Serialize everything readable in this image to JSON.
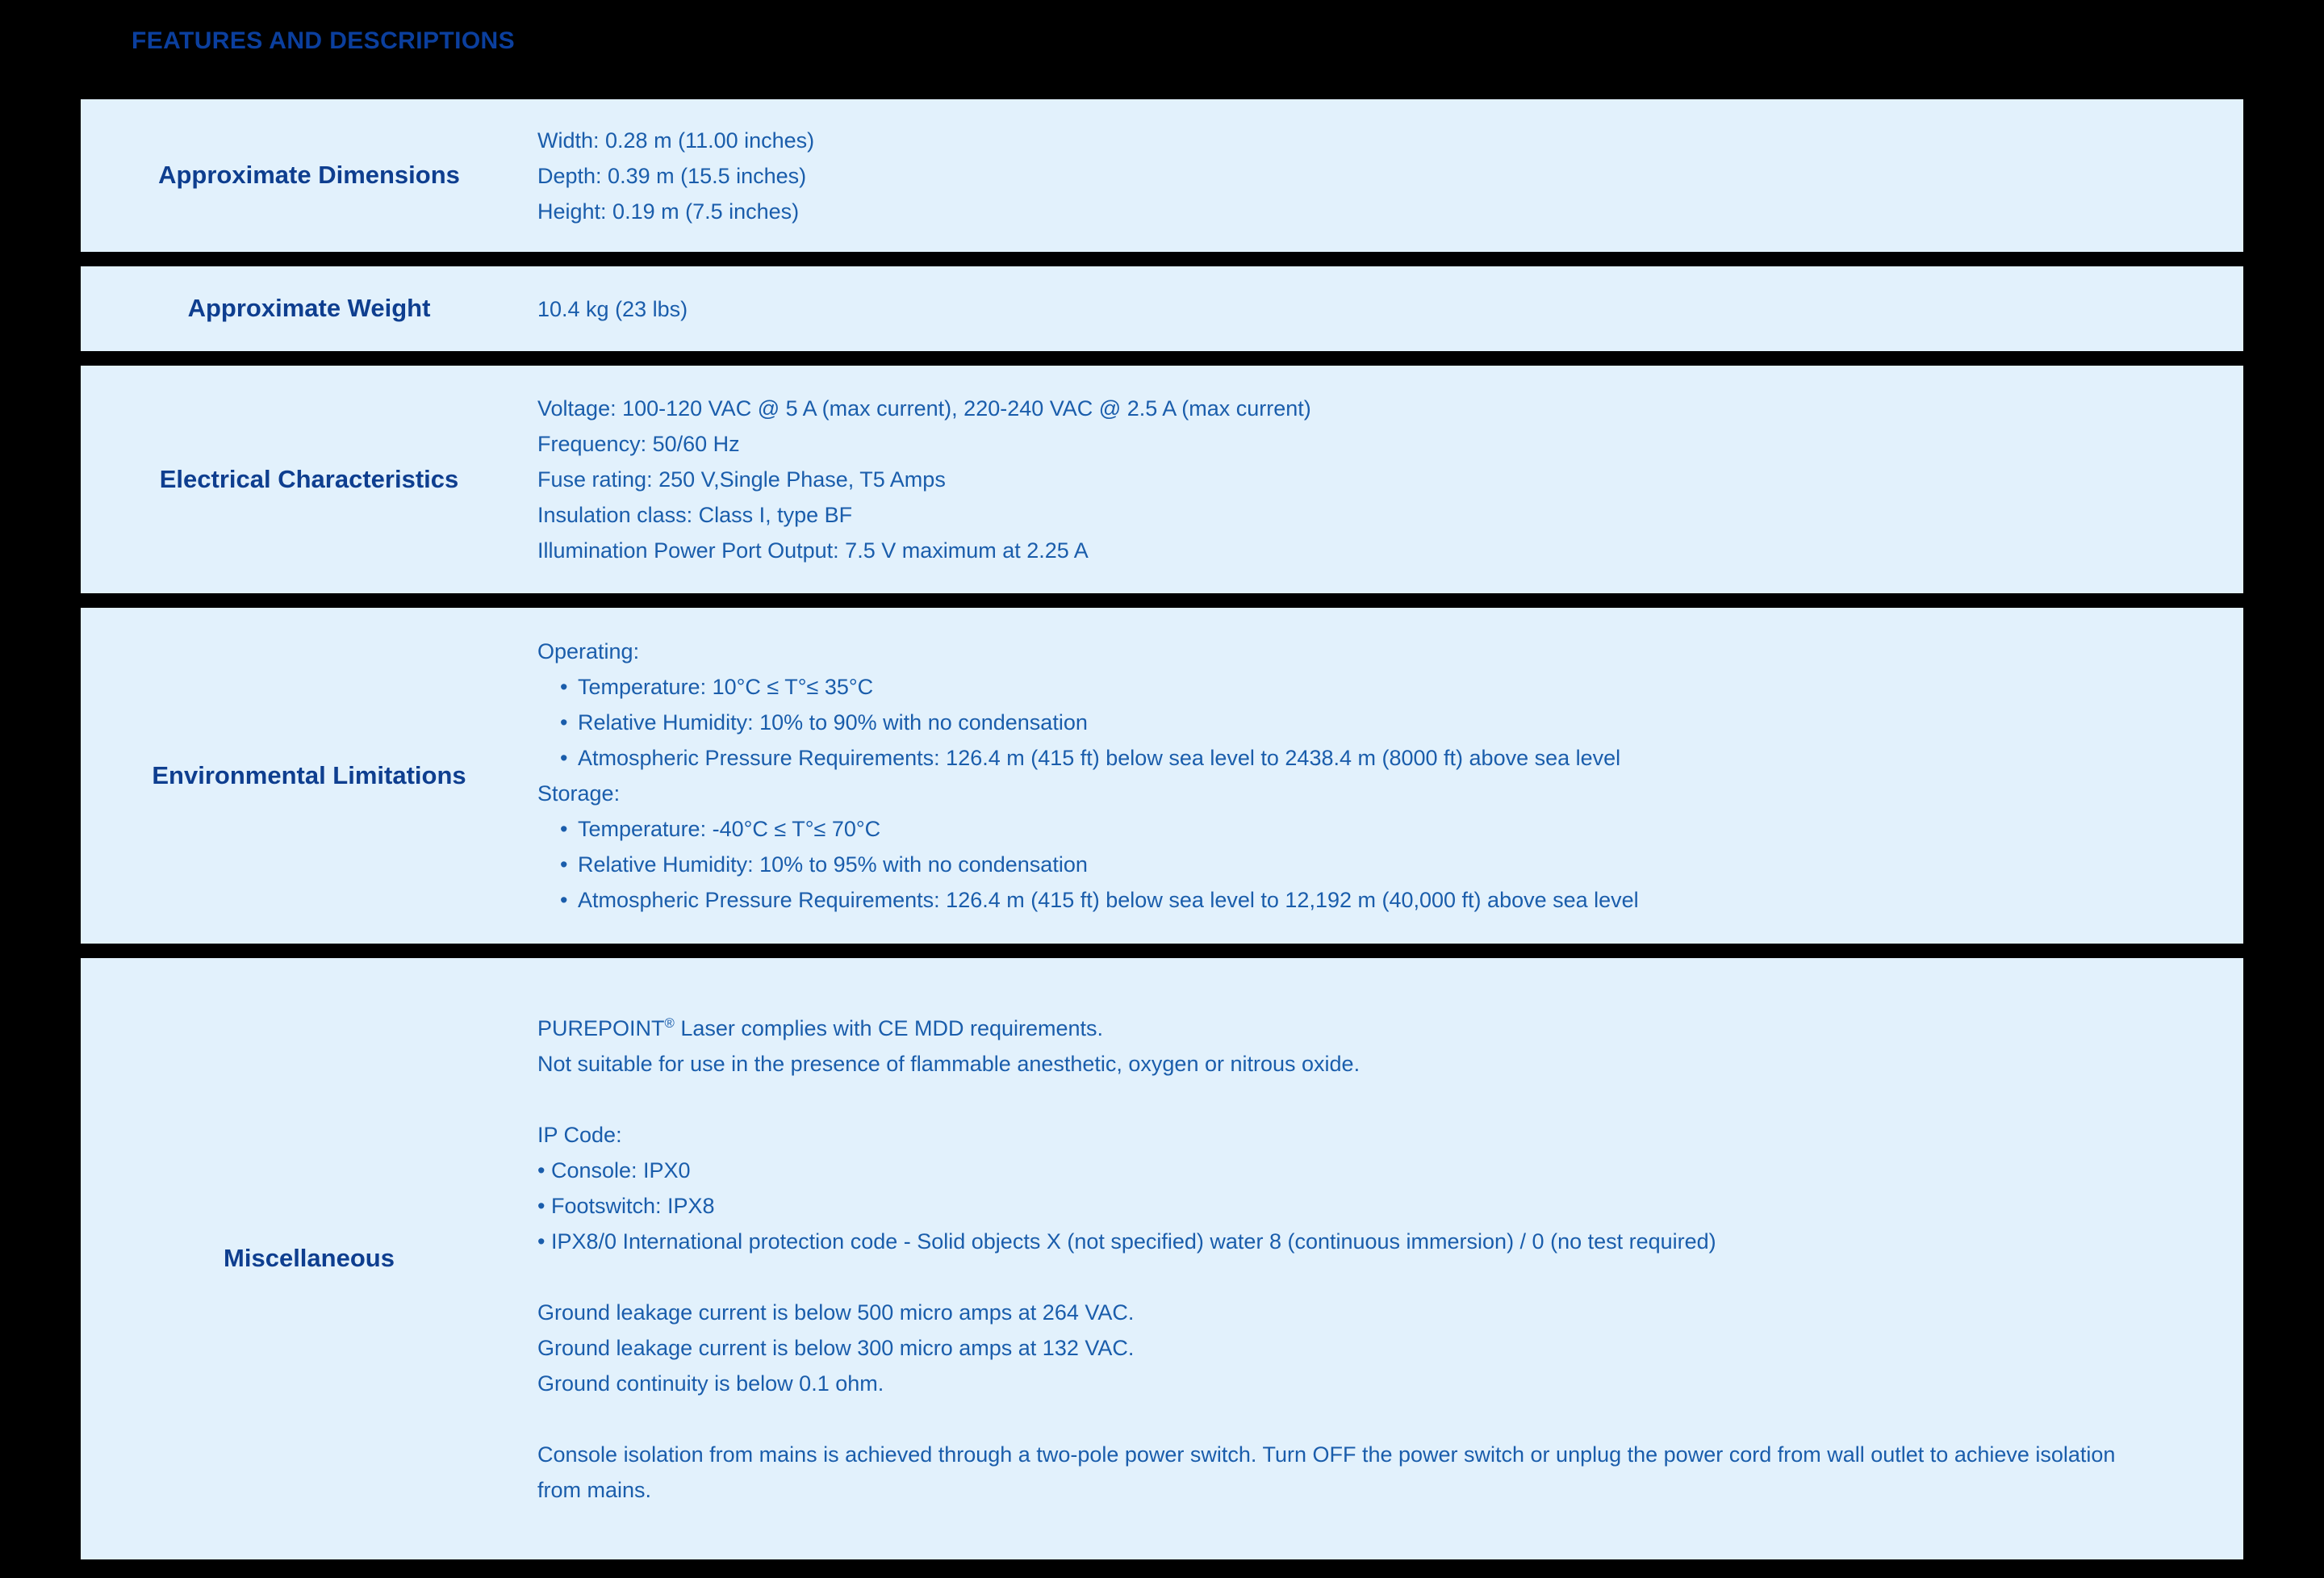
{
  "header": {
    "title": "FEATURES AND DESCRIPTIONS"
  },
  "colors": {
    "page_background": "#000000",
    "panel_background": "#e2f1fc",
    "heading": "#0b3f9e",
    "label": "#0e3e8f",
    "value": "#1a5dab"
  },
  "rows": [
    {
      "label": "Approximate Dimensions",
      "lines": [
        "Width: 0.28 m (11.00 inches)",
        "Depth: 0.39 m (15.5 inches)",
        "Height: 0.19 m (7.5 inches)"
      ]
    },
    {
      "label": "Approximate Weight",
      "lines": [
        "10.4 kg (23 lbs)"
      ]
    },
    {
      "label": "Electrical Characteristics",
      "lines": [
        "Voltage: 100-120 VAC @ 5 A (max current), 220-240 VAC @ 2.5 A (max current)",
        "Frequency: 50/60 Hz",
        "Fuse rating: 250 V,Single Phase, T5 Amps",
        "Insulation class: Class I, type BF",
        "Illumination Power Port Output: 7.5 V maximum at 2.25 A"
      ]
    },
    {
      "label": "Environmental Limitations",
      "lines": [
        "Operating:",
        "Temperature: 10°C ≤ T°≤ 35°C",
        "Relative Humidity: 10% to 90% with no condensation",
        "Atmospheric Pressure Requirements: 126.4 m (415 ft) below sea level to 2438.4 m (8000 ft) above sea level",
        "Storage:",
        "Temperature: -40°C ≤ T°≤ 70°C",
        "Relative Humidity: 10% to 95% with no condensation",
        "Atmospheric Pressure Requirements: 126.4 m (415 ft) below sea level to 12,192 m (40,000 ft) above sea level"
      ]
    },
    {
      "label": "Miscellaneous",
      "lines": [
        "PUREPOINT® Laser complies with CE MDD requirements.",
        "Not suitable for use in the presence of flammable anesthetic, oxygen or nitrous oxide.",
        "IP Code:",
        "• Console: IPX0",
        "• Footswitch: IPX8",
        "• IPX8/0 International protection code - Solid objects X (not specified) water 8 (continuous immersion) / 0 (no test required)",
        "Ground leakage current is below 500 micro amps at 264 VAC.",
        "Ground leakage current is below 300 micro amps at 132 VAC.",
        "Ground continuity is below 0.1 ohm.",
        "Console isolation from mains is achieved through a two-pole power switch. Turn OFF the power switch or unplug the power cord from wall outlet to achieve isolation from mains."
      ]
    }
  ],
  "misc_parts": {
    "purepoint_prefix": "PUREPOINT",
    "purepoint_mark": "®",
    "purepoint_suffix": " Laser complies with CE MDD requirements."
  },
  "bullet_glyph": "•"
}
